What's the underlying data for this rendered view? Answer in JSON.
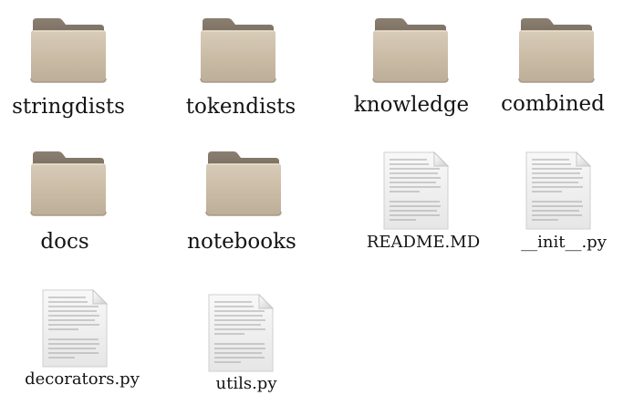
{
  "folder_view": {
    "items": [
      {
        "label": "stringdists",
        "type": "folder",
        "icon": "folder-icon"
      },
      {
        "label": "tokendists",
        "type": "folder",
        "icon": "folder-icon"
      },
      {
        "label": "knowledge",
        "type": "folder",
        "icon": "folder-icon"
      },
      {
        "label": "combined",
        "type": "folder",
        "icon": "folder-icon"
      },
      {
        "label": "docs",
        "type": "folder",
        "icon": "folder-icon"
      },
      {
        "label": "notebooks",
        "type": "folder",
        "icon": "folder-icon"
      },
      {
        "label": "README.MD",
        "type": "file",
        "icon": "text-file-icon"
      },
      {
        "label": "__init__.py",
        "type": "file",
        "icon": "text-file-icon"
      },
      {
        "label": "decorators.py",
        "type": "file",
        "icon": "text-file-icon"
      },
      {
        "label": "utils.py",
        "type": "file",
        "icon": "text-file-icon"
      }
    ]
  },
  "colors": {
    "folder_back": "#7d7264",
    "folder_front": "#cdbfa9",
    "folder_edge": "#a89a86",
    "file_paper": "#f1f1f1",
    "file_text_lines": "#9a9a9a",
    "background": "#ffffff"
  }
}
